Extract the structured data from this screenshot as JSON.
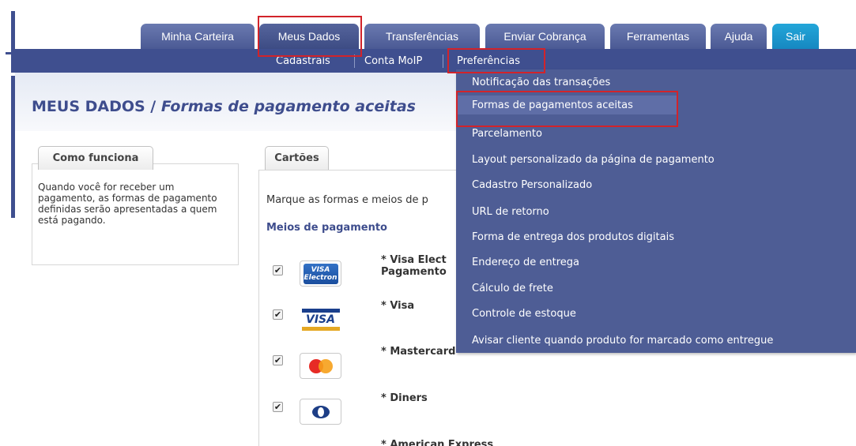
{
  "tabs": [
    {
      "label": "Minha Carteira"
    },
    {
      "label": "Meus Dados"
    },
    {
      "label": "Transferências"
    },
    {
      "label": "Enviar Cobrança"
    },
    {
      "label": "Ferramentas"
    },
    {
      "label": "Ajuda"
    },
    {
      "label": "Sair"
    }
  ],
  "subnav": [
    {
      "label": "Cadastrais"
    },
    {
      "label": "Conta MoIP"
    },
    {
      "label": "Preferências"
    }
  ],
  "page": {
    "title_prefix": "MEUS DADOS /",
    "title_italic": "Formas de pagamento aceitas"
  },
  "left_box": {
    "tab_label": "Como funciona",
    "text": "Quando você for receber um pagamento, as formas de pagamento definidas serão apresentadas a quem está pagando."
  },
  "right_box": {
    "tab_label": "Cartões",
    "instruction": "Marque as formas e meios de p",
    "section_title": "Meios de pagamento",
    "methods": [
      {
        "label_line1": "* Visa Elect",
        "label_line2": "Pagamento",
        "checked": true,
        "logo": "visa-electron"
      },
      {
        "label_line1": "* Visa",
        "label_line2": "",
        "checked": true,
        "logo": "visa"
      },
      {
        "label_line1": "* Mastercard",
        "label_line2": "",
        "checked": true,
        "logo": "mastercard"
      },
      {
        "label_line1": "* Diners",
        "label_line2": "",
        "checked": true,
        "logo": "diners"
      },
      {
        "label_line1": "* American Express",
        "label_line2": "",
        "checked": false,
        "logo": "amex"
      }
    ],
    "visa_electron_logo_text": [
      "VISA",
      "Electron"
    ],
    "visa_logo_text": "VISA"
  },
  "dropdown": {
    "items": [
      {
        "label": "Notificação das transações"
      },
      {
        "label": "Formas de pagamentos aceitas"
      },
      {
        "label": "Parcelamento"
      },
      {
        "label": "Layout personalizado da página de pagamento"
      },
      {
        "label": "Cadastro Personalizado"
      },
      {
        "label": "URL de retorno"
      },
      {
        "label": "Forma de entrega dos produtos digitais"
      },
      {
        "label": "Endereço de entrega"
      },
      {
        "label": "Cálculo de frete"
      },
      {
        "label": "Controle de estoque"
      },
      {
        "label": "Avisar cliente quando produto for marcado como entregue"
      }
    ]
  },
  "colors": {
    "nav": "#3f4f8f",
    "dropdown": "#4e5d95",
    "sair_tab": "#1a93cc",
    "highlight_box": "#d2232a",
    "title": "#3e4d8d"
  }
}
